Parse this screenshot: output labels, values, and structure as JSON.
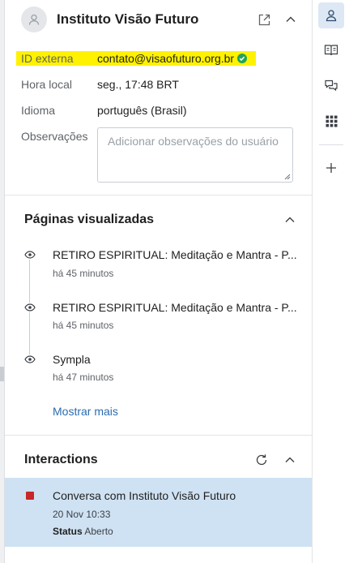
{
  "contact": {
    "name": "Instituto Visão Futuro"
  },
  "details": {
    "external_id_label": "ID externa",
    "external_id_value": "contato@visaofuturo.org.br",
    "local_time_label": "Hora local",
    "local_time_value": "seg., 17:48 BRT",
    "language_label": "Idioma",
    "language_value": "português (Brasil)",
    "notes_label": "Observações",
    "notes_placeholder": "Adicionar observações do usuário"
  },
  "pages_viewed": {
    "title": "Páginas visualizadas",
    "items": [
      {
        "title": "RETIRO ESPIRITUAL: Meditação e Mantra - P...",
        "time": "há 45 minutos"
      },
      {
        "title": "RETIRO ESPIRITUAL: Meditação e Mantra - P...",
        "time": "há 45 minutos"
      },
      {
        "title": "Sympla",
        "time": "há 47 minutos"
      }
    ],
    "show_more": "Mostrar mais"
  },
  "interactions": {
    "title": "Interactions",
    "items": [
      {
        "title": "Conversa com Instituto Visão Futuro",
        "date": "20 Nov 10:33",
        "status_label": "Status",
        "status_value": "Aberto",
        "status_color": "#c8282a"
      }
    ]
  },
  "colors": {
    "highlight": "#fff200",
    "verified": "#22a35a",
    "link": "#2b6cb0",
    "selected_row": "#cfe2f3",
    "rail_active": "#dde8f4"
  },
  "icons": {
    "header": [
      "user-avatar-icon",
      "open-external-icon",
      "chevron-up-icon"
    ],
    "rail": [
      "user-icon",
      "knowledge-book-icon",
      "chat-bubbles-icon",
      "apps-grid-icon",
      "plus-icon"
    ]
  }
}
